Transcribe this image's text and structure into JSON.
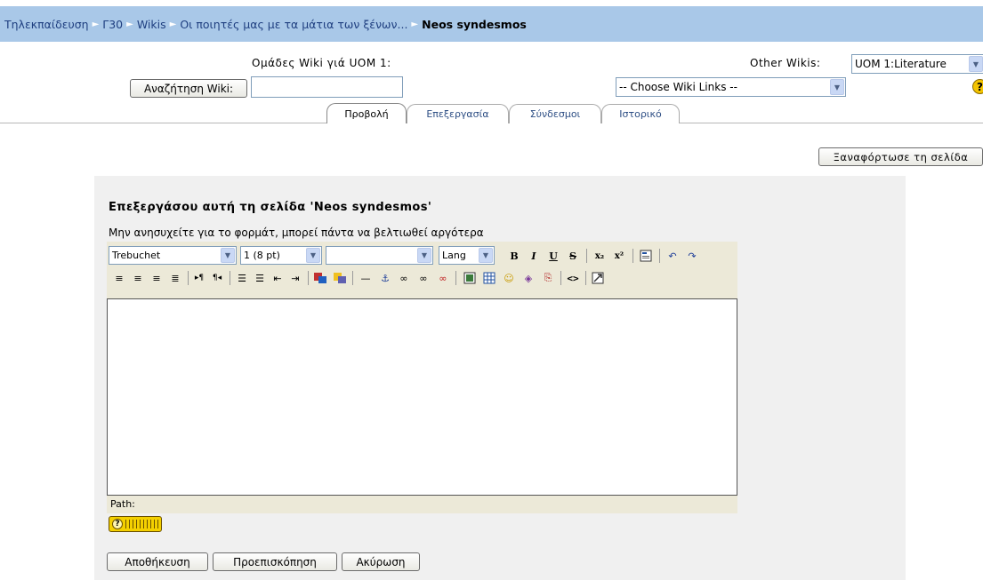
{
  "breadcrumb": {
    "items": [
      "Τηλεκπαίδευση",
      "Γ30",
      "Wikis",
      "Οι ποιητές μας με τα μάτια των ξένων..."
    ],
    "separator": "►",
    "current": "Neos syndesmos"
  },
  "wiki_header": {
    "groups_label": "Ομάδες Wiki γιά UOM 1:",
    "other_wikis_label": "Other Wikis:",
    "other_wikis_value": "UOM 1:Literature",
    "search_button": "Αναζήτηση Wiki:",
    "search_value": "",
    "wiki_links_value": "-- Choose Wiki Links --",
    "help_icon": "help-icon"
  },
  "tabs": [
    {
      "label": "Προβολή",
      "active": true
    },
    {
      "label": "Επεξεργασία",
      "active": false
    },
    {
      "label": "Σύνδεσμοι",
      "active": false
    },
    {
      "label": "Ιστορικό",
      "active": false
    }
  ],
  "reload_button": "Ξαναφόρτωσε τη σελίδα",
  "editor": {
    "heading": "Επεξεργάσου αυτή τη σελίδα 'Neos syndesmos'",
    "hint": "Μην ανησυχείτε για το φορμάτ, μπορεί πάντα να βελτιωθεί αργότερα",
    "font_value": "Trebuchet",
    "size_value": "1 (8 pt)",
    "format_value": "",
    "lang_value": "Lang",
    "toolbar_row1": {
      "bold": "B",
      "italic": "I",
      "underline": "U",
      "strike": "S",
      "subscript": "x₂",
      "superscript": "x²"
    },
    "content": "",
    "path_label": "Path:"
  },
  "actions": {
    "save": "Αποθήκευση",
    "preview": "Προεπισκόπηση",
    "cancel": "Ακύρωση"
  }
}
